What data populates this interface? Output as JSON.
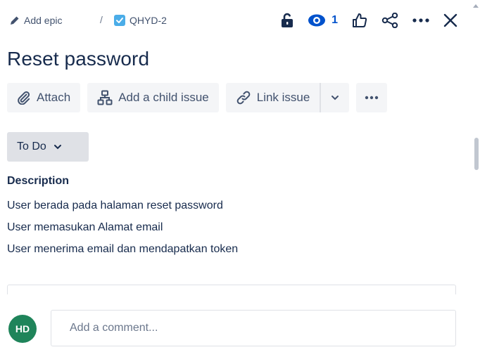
{
  "breadcrumb": {
    "epic_label": "Add epic",
    "separator": "/",
    "issue_key": "QHYD-2"
  },
  "header_actions": {
    "watch_count": "1"
  },
  "issue": {
    "title": "Reset password"
  },
  "actions": {
    "attach_label": "Attach",
    "add_child_label": "Add a child issue",
    "link_label": "Link issue"
  },
  "status": {
    "label": "To Do"
  },
  "description": {
    "label": "Description",
    "lines": [
      "User berada pada halaman reset password",
      "User memasukan Alamat email",
      "User menerima email dan mendapatkan token"
    ]
  },
  "comment": {
    "avatar_initials": "HD",
    "placeholder": "Add a comment..."
  },
  "colors": {
    "accent": "#0052cc",
    "issue_type": "#4bade8",
    "avatar": "#1f845a",
    "button_bg": "#f4f5f7",
    "status_bg": "#dfe1e6"
  }
}
